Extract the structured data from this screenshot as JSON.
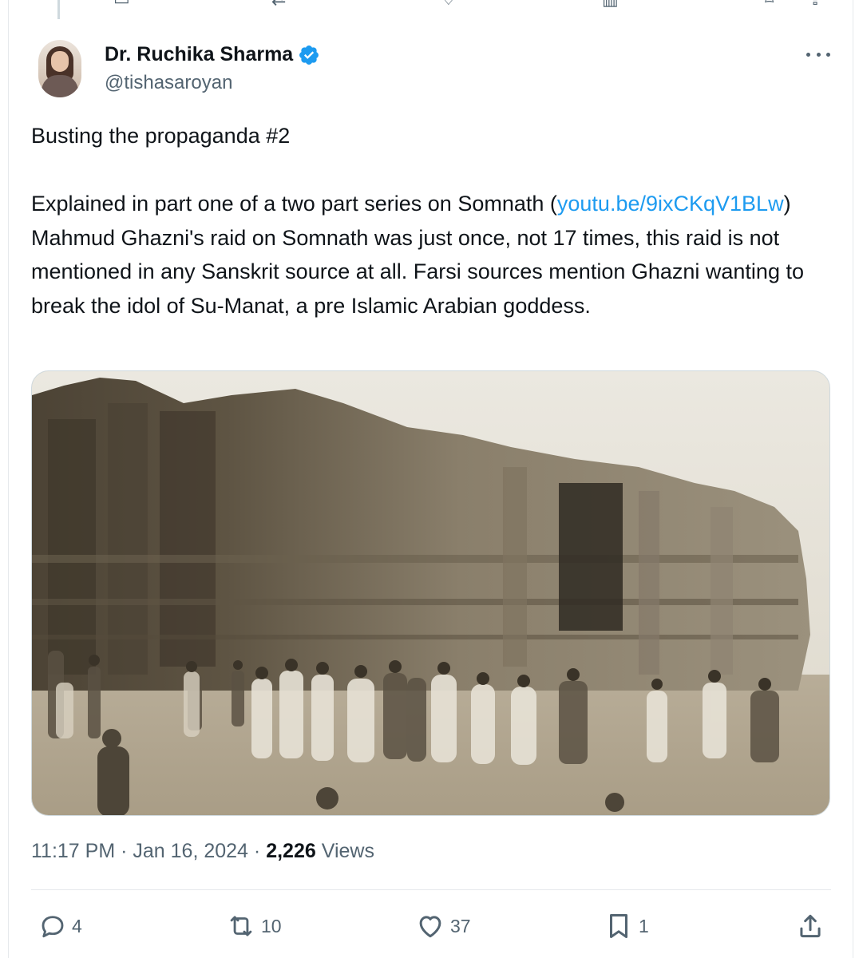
{
  "author": {
    "display_name": "Dr. Ruchika Sharma",
    "handle": "@tishasaroyan",
    "verified": true
  },
  "tweet": {
    "line1": "Busting the propaganda #2",
    "body_prefix": "Explained in part one of a two part series on Somnath (",
    "link_text": "youtu.be/9ixCKqV1BLw",
    "body_suffix": ") Mahmud Ghazni's raid on Somnath was just once, not 17 times, this raid is not mentioned in any Sanskrit source at all. Farsi sources mention Ghazni wanting to break the idol of Su-Manat, a pre Islamic Arabian goddess."
  },
  "meta": {
    "time": "11:17 PM",
    "separator": "·",
    "date": "Jan 16, 2024",
    "views_count": "2,226",
    "views_label": "Views"
  },
  "actions": {
    "replies": "4",
    "reposts": "10",
    "likes": "37",
    "bookmarks": "1"
  },
  "icons": {
    "verified": "verified-badge-icon",
    "more": "more-options-icon",
    "reply": "reply-icon",
    "repost": "repost-icon",
    "like": "heart-icon",
    "bookmark": "bookmark-icon",
    "share": "share-icon"
  },
  "colors": {
    "link": "#1d9bf0",
    "secondary_text": "#536471",
    "primary_text": "#0f1419",
    "verified": "#1d9bf0"
  }
}
